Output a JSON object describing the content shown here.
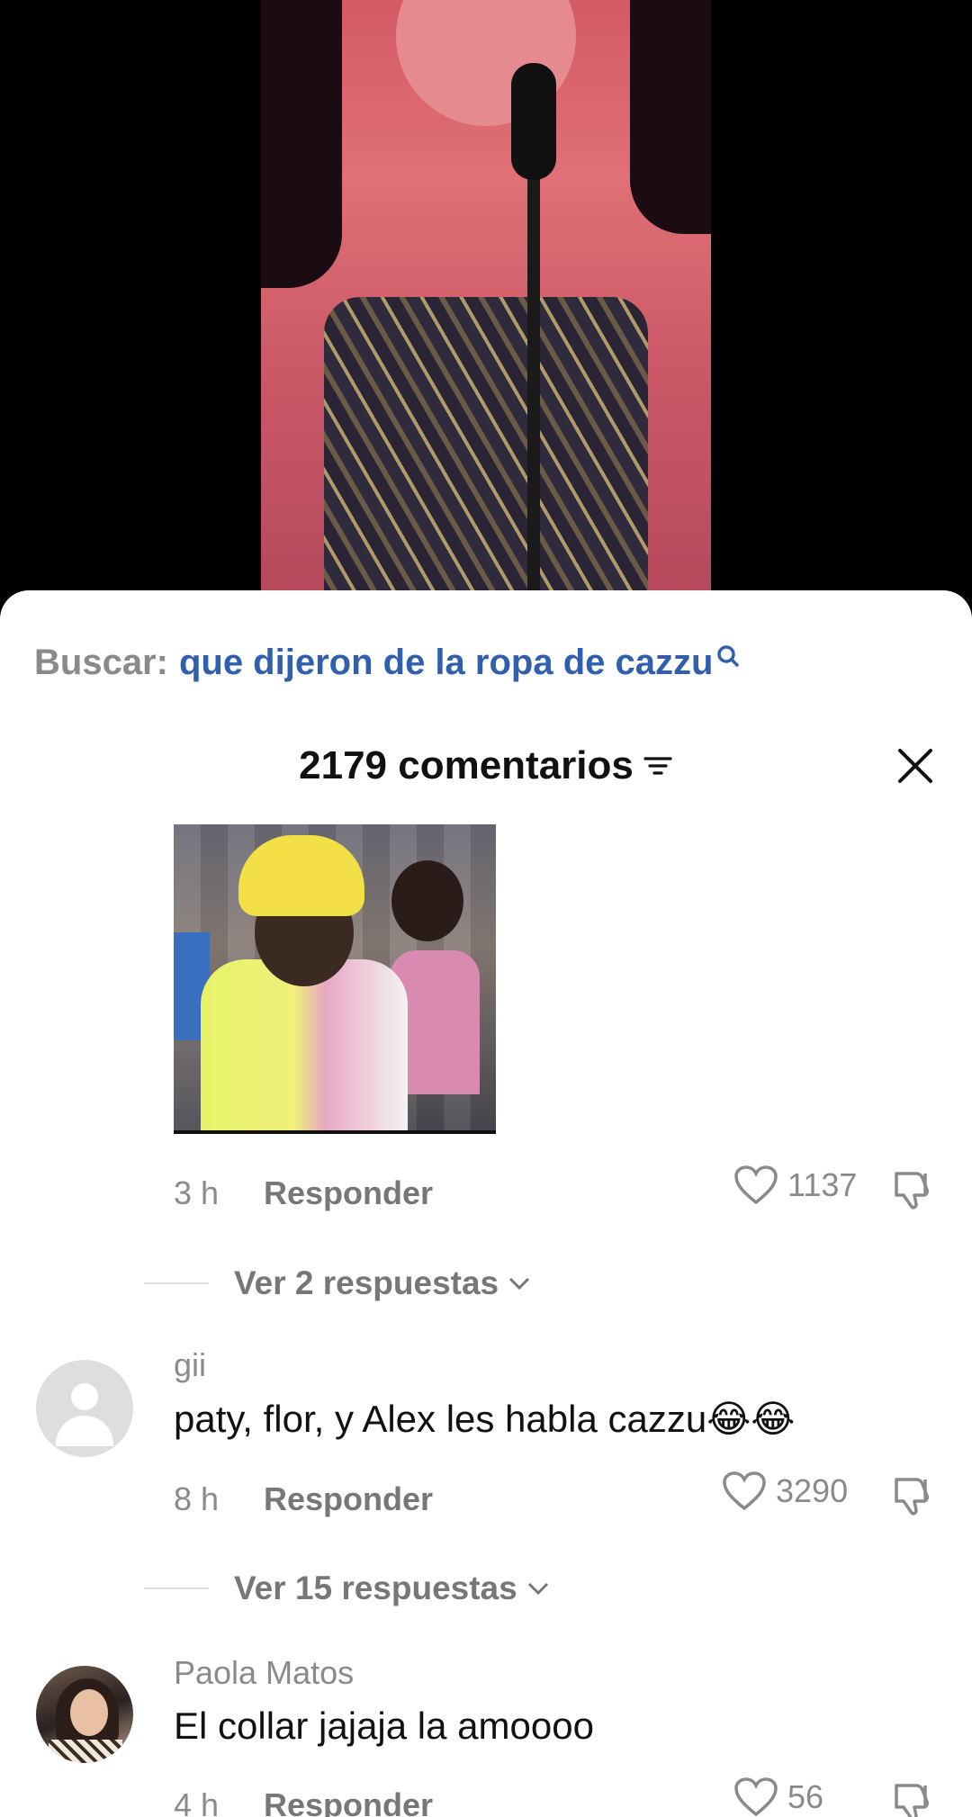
{
  "search": {
    "prefix": "Buscar:",
    "query": "que dijeron de la ropa de cazzu"
  },
  "header": {
    "count_title": "2179 comentarios"
  },
  "comments": [
    {
      "time": "3 h",
      "reply_label": "Responder",
      "likes": "1137",
      "view_replies": "Ver 2 respuestas"
    },
    {
      "username": "gii",
      "text": "paty, flor, y Alex les habla cazzu😂😂",
      "time": "8 h",
      "reply_label": "Responder",
      "likes": "3290",
      "view_replies": "Ver 15 respuestas"
    },
    {
      "username": "Paola Matos",
      "text": "El collar jajaja la amoooo",
      "time": "4 h",
      "reply_label": "Responder",
      "likes": "56"
    }
  ],
  "colors": {
    "search_link": "#2f5fae",
    "muted": "#8a8a8a",
    "sheet_bg": "#ffffff"
  },
  "icons": [
    "search-icon",
    "sort-icon",
    "close-icon",
    "heart-icon",
    "dislike-icon",
    "chevron-down-icon"
  ]
}
